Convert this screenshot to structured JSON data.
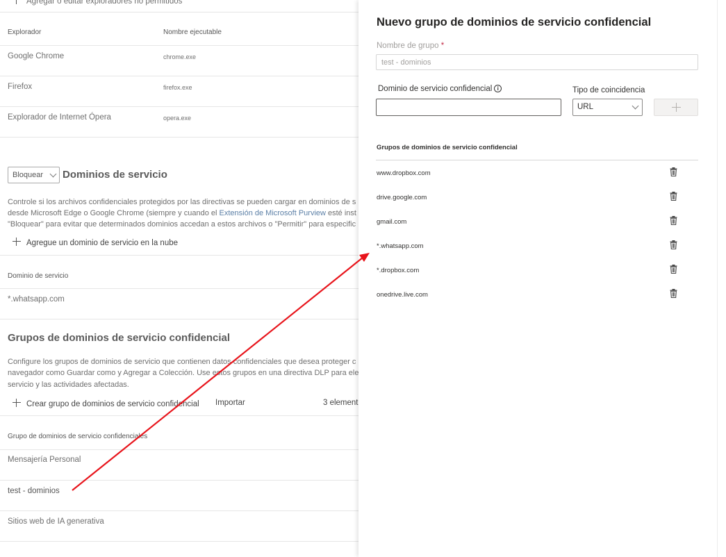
{
  "background": {
    "top_partial_action": "Agregar o editar exploradores no permitidos",
    "browsers_table": {
      "headers": [
        "Explorador",
        "Nombre ejecutable"
      ],
      "rows": [
        {
          "name": "Google Chrome",
          "exe": "chrome.exe"
        },
        {
          "name": "Firefox",
          "exe": "firefox.exe"
        },
        {
          "name": "Explorador de Internet Ópera",
          "exe": "opera.exe"
        }
      ]
    },
    "service_domains": {
      "mode_select": "Bloquear",
      "title": "Dominios de servicio",
      "desc_line1": "Controle si los archivos confidenciales protegidos por las directivas se pueden cargar en dominios de s",
      "desc_line2_pre": "desde Microsoft Edge o Google Chrome (siempre y cuando el ",
      "desc_line2_link": "Extensión de Microsoft Purview",
      "desc_line2_post": " esté inst",
      "desc_line3": "\"Bloquear\" para evitar que determinados dominios accedan a estos archivos o \"Permitir\" para especific",
      "add_action": "Agregue un dominio de servicio en la nube",
      "column_header": "Dominio de servicio",
      "rows": [
        "*.whatsapp.com"
      ]
    },
    "groups_section": {
      "title": "Grupos de dominios de servicio confidencial",
      "desc_line1": "Configure los grupos de dominios de servicio que contienen datos confidenciales que desea proteger c",
      "desc_line2": "navegador como Guardar como y Agregar a Colección. Use estos grupos en una directiva DLP para ele",
      "desc_line3": "servicio y las actividades afectadas.",
      "create_action": "Crear grupo de dominios de servicio confidencial",
      "import_action": "Importar",
      "count": "3 element",
      "column_header": "Grupo de dominios de servicio confidenciales",
      "rows": [
        "Mensajería Personal",
        "test - dominios",
        "Sitios web de IA generativa"
      ]
    }
  },
  "panel": {
    "title": "Nuevo grupo de dominios de servicio confidencial",
    "group_name_label": "Nombre de grupo",
    "required_mark": "*",
    "group_name_value": "test - dominios",
    "domain_label": "Dominio de servicio confidencial",
    "info_glyph": "i",
    "domain_value": "",
    "match_label": "Tipo de coincidencia",
    "match_value": "URL",
    "list_header": "Grupos de dominios de servicio confidencial",
    "domains": [
      "www.dropbox.com",
      "drive.google.com",
      "gmail.com",
      "*.whatsapp.com",
      "*.dropbox.com",
      "onedrive.live.com"
    ]
  },
  "annotation": {
    "arrow_color": "#e8141b"
  },
  "icons": {
    "add": "plus-icon",
    "delete": "trash-icon",
    "info": "info-icon",
    "dropdown": "chevron-down-icon"
  }
}
